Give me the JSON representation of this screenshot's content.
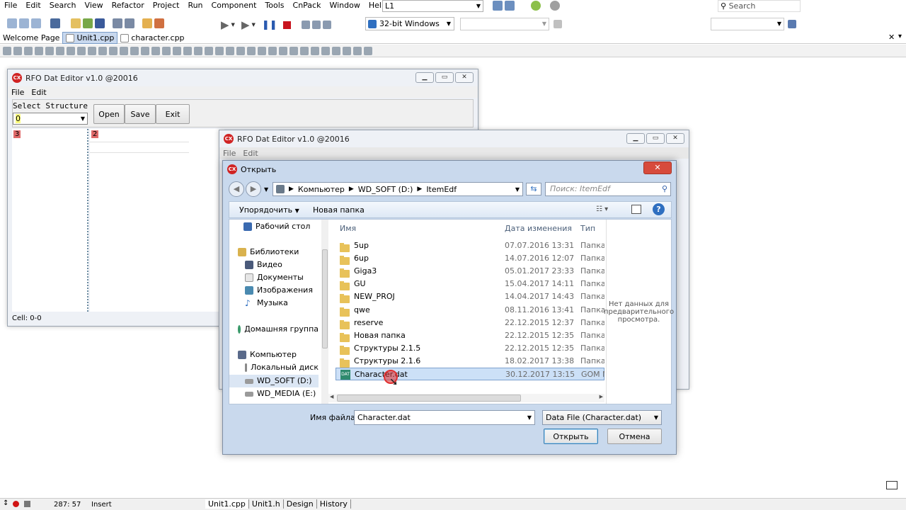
{
  "ide": {
    "menu": [
      "File",
      "Edit",
      "Search",
      "View",
      "Refactor",
      "Project",
      "Run",
      "Component",
      "Tools",
      "CnPack",
      "Window",
      "Help"
    ],
    "target_combo": "L1",
    "search_placeholder": "Search",
    "platform_combo": "32-bit Windows",
    "file_tabs": [
      "Welcome Page",
      "Unit1.cpp",
      "character.cpp"
    ],
    "status": {
      "position": "287: 57",
      "mode": "Insert"
    },
    "bottom_tabs": [
      "Unit1.cpp",
      "Unit1.h",
      "Design",
      "History"
    ]
  },
  "back_window": {
    "title": "RFO Dat Editor v1.0 @20016",
    "menu": [
      "File",
      "Edit"
    ],
    "select_label": "Select Structure",
    "select_value": "0",
    "buttons": {
      "open": "Open",
      "save": "Save",
      "exit": "Exit"
    },
    "grid1_marker": "3",
    "grid2_marker": "2",
    "cell_status": "Cell: 0-0"
  },
  "mid_window": {
    "title": "RFO Dat Editor v1.0 @20016",
    "menu": [
      "File",
      "Edit"
    ]
  },
  "dialog": {
    "title": "Открыть",
    "breadcrumb": [
      "Компьютер",
      "WD_SOFT (D:)",
      "ItemEdf"
    ],
    "search_placeholder": "Поиск: ItemEdf",
    "organize": "Упорядочить",
    "new_folder": "Новая папка",
    "nav": [
      {
        "label": "Рабочий стол",
        "indent": 2
      },
      {
        "label": "Библиотеки",
        "indent": 1
      },
      {
        "label": "Видео",
        "indent": 2
      },
      {
        "label": "Документы",
        "indent": 2
      },
      {
        "label": "Изображения",
        "indent": 2
      },
      {
        "label": "Музыка",
        "indent": 2
      },
      {
        "label": "Домашняя группа",
        "indent": 1
      },
      {
        "label": "Компьютер",
        "indent": 1
      },
      {
        "label": "Локальный диск",
        "indent": 2
      },
      {
        "label": "WD_SOFT (D:)",
        "indent": 2,
        "selected": true
      },
      {
        "label": "WD_MEDIA (E:)",
        "indent": 2
      }
    ],
    "columns": {
      "name": "Имя",
      "date": "Дата изменения",
      "type": "Тип"
    },
    "files": [
      {
        "name": "5up",
        "date": "07.07.2016 13:31",
        "type": "Папка",
        "kind": "folder"
      },
      {
        "name": "6up",
        "date": "14.07.2016 12:07",
        "type": "Папка",
        "kind": "folder"
      },
      {
        "name": "Giga3",
        "date": "05.01.2017 23:33",
        "type": "Папка",
        "kind": "folder"
      },
      {
        "name": "GU",
        "date": "15.04.2017 14:11",
        "type": "Папка",
        "kind": "folder"
      },
      {
        "name": "NEW_PROJ",
        "date": "14.04.2017 14:43",
        "type": "Папка",
        "kind": "folder"
      },
      {
        "name": "qwe",
        "date": "08.11.2016 13:41",
        "type": "Папка",
        "kind": "folder"
      },
      {
        "name": "reserve",
        "date": "22.12.2015 12:37",
        "type": "Папка",
        "kind": "folder"
      },
      {
        "name": "Новая папка",
        "date": "22.12.2015 12:35",
        "type": "Папка",
        "kind": "folder"
      },
      {
        "name": "Структуры 2.1.5",
        "date": "22.12.2015 12:35",
        "type": "Папка",
        "kind": "folder"
      },
      {
        "name": "Структуры 2.1.6",
        "date": "18.02.2017 13:38",
        "type": "Папка",
        "kind": "folder"
      },
      {
        "name": "Character.dat",
        "date": "30.12.2017 13:15",
        "type": "GOM M",
        "kind": "dat",
        "selected": true
      }
    ],
    "preview_text": "Нет данных для предварительного просмотра.",
    "filename_label": "Имя файла:",
    "filename_value": "Character.dat",
    "filter_value": "Data File (Character.dat)",
    "open_button": "Открыть",
    "cancel_button": "Отмена"
  }
}
